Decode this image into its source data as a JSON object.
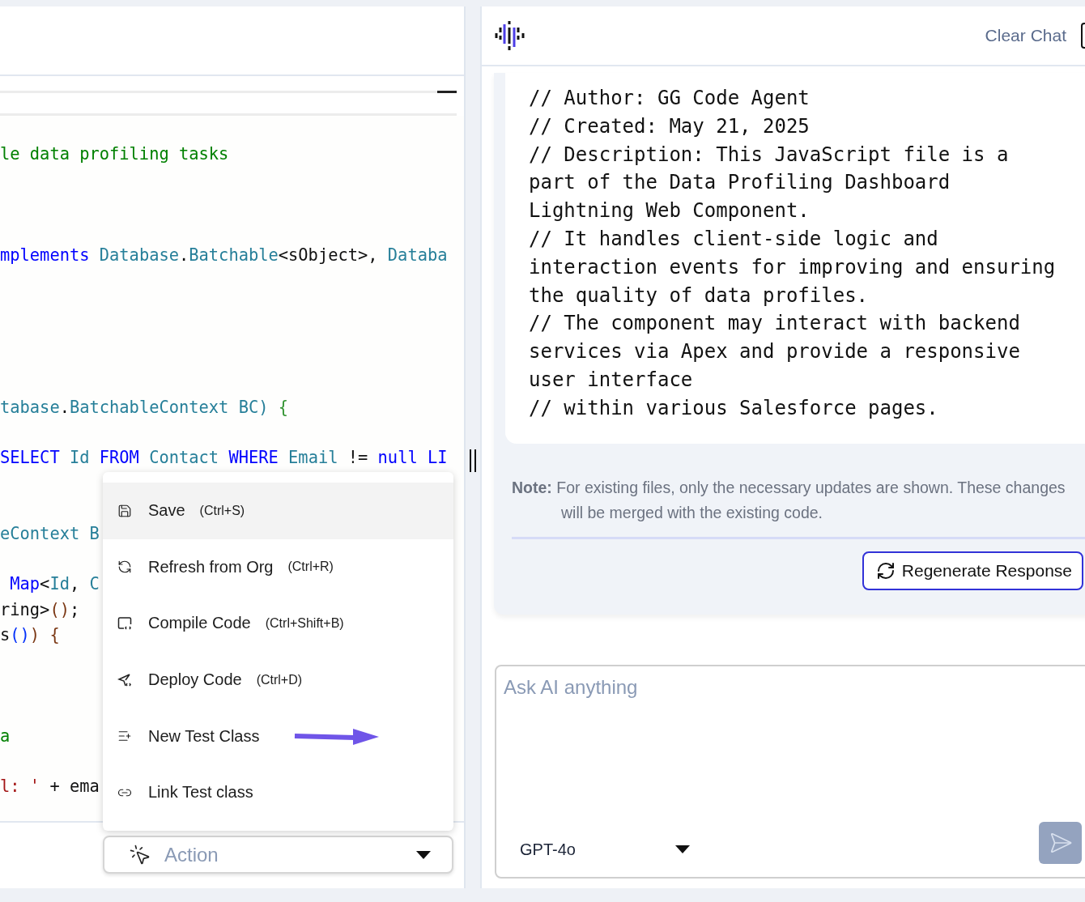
{
  "editor": {
    "code_lines": [
      {
        "kind": "code",
        "tokens": [
          {
            "text": "le data profiling tasks",
            "kind": "comment"
          }
        ]
      },
      {
        "kind": "blank"
      },
      {
        "kind": "blank"
      },
      {
        "kind": "blank"
      },
      {
        "kind": "code",
        "tokens": [
          {
            "text": "mplements",
            "kind": "keyword"
          },
          {
            "text": " Database",
            "kind": "type"
          },
          {
            "text": ".",
            "kind": "plain"
          },
          {
            "text": "Batchable",
            "kind": "type"
          },
          {
            "text": "<sObject>, ",
            "kind": "plain"
          },
          {
            "text": "Databa",
            "kind": "type"
          }
        ]
      },
      {
        "kind": "blank"
      },
      {
        "kind": "blank"
      },
      {
        "kind": "blank"
      },
      {
        "kind": "blank"
      },
      {
        "kind": "blank"
      },
      {
        "kind": "code",
        "tokens": [
          {
            "text": "tabase",
            "kind": "type"
          },
          {
            "text": ".",
            "kind": "plain"
          },
          {
            "text": "BatchableContext BC)",
            "kind": "type"
          },
          {
            "text": " {",
            "kind": "bracket_green"
          }
        ]
      },
      {
        "kind": "blank"
      },
      {
        "kind": "code",
        "tokens": [
          {
            "text": "SELECT",
            "kind": "keyword"
          },
          {
            "text": " Id",
            "kind": "type"
          },
          {
            "text": " FROM",
            "kind": "keyword"
          },
          {
            "text": " Contact",
            "kind": "type"
          },
          {
            "text": " WHERE",
            "kind": "keyword"
          },
          {
            "text": " Email",
            "kind": "type"
          },
          {
            "text": " != ",
            "kind": "plain"
          },
          {
            "text": "null LI",
            "kind": "keyword"
          }
        ]
      },
      {
        "kind": "blank"
      },
      {
        "kind": "blank"
      },
      {
        "kind": "code",
        "tokens": [
          {
            "text": "eContext B",
            "kind": "type"
          }
        ]
      },
      {
        "kind": "blank"
      },
      {
        "kind": "code",
        "tokens": [
          {
            "text": " Map",
            "kind": "keyword"
          },
          {
            "text": "<",
            "kind": "plain"
          },
          {
            "text": "Id",
            "kind": "type"
          },
          {
            "text": ", ",
            "kind": "plain"
          },
          {
            "text": "C",
            "kind": "type"
          }
        ]
      },
      {
        "kind": "code",
        "tokens": [
          {
            "text": "ring>",
            "kind": "plain"
          },
          {
            "text": "()",
            "kind": "bracket_brown"
          },
          {
            "text": ";",
            "kind": "plain"
          }
        ]
      },
      {
        "kind": "code",
        "tokens": [
          {
            "text": "s",
            "kind": "plain"
          },
          {
            "text": "()",
            "kind": "bracket_blue"
          },
          {
            "text": ") {",
            "kind": "bracket_brown"
          }
        ]
      },
      {
        "kind": "blank"
      },
      {
        "kind": "blank"
      },
      {
        "kind": "blank"
      },
      {
        "kind": "code",
        "tokens": [
          {
            "text": "a",
            "kind": "comment"
          }
        ]
      },
      {
        "kind": "blank"
      },
      {
        "kind": "code",
        "tokens": [
          {
            "text": "l: '",
            "kind": "string"
          },
          {
            "text": " + ema",
            "kind": "plain"
          }
        ]
      }
    ],
    "action_menu": [
      {
        "label": "Save",
        "shortcut": "(Ctrl+S)",
        "selected": true
      },
      {
        "label": "Refresh from Org",
        "shortcut": "(Ctrl+R)",
        "selected": false
      },
      {
        "label": "Compile Code",
        "shortcut": "(Ctrl+Shift+B)",
        "selected": false
      },
      {
        "label": "Deploy Code",
        "shortcut": "(Ctrl+D)",
        "selected": false
      },
      {
        "label": "New Test Class",
        "selected": false
      },
      {
        "label": "Link Test class",
        "selected": false
      }
    ],
    "action_dropdown": {
      "label": "Action"
    }
  },
  "chat": {
    "clear_button": "Clear Chat",
    "code_comment_lines": [
      "// Author: GG Code Agent",
      "// Created: May 21, 2025",
      "// Description: This JavaScript file is a part of the Data Profiling Dashboard Lightning Web Component.",
      "// It handles client-side logic and interaction events for improving and ensuring the quality of data profiles.",
      "// The component may interact with backend services via Apex and provide a responsive user interface",
      "// within various Salesforce pages."
    ],
    "note": "**Note:** For existing files, only the necessary updates are shown. These changes will be merged with the existing code.",
    "regenerate_button": "Regenerate Response",
    "input": {
      "placeholder": "Ask AI anything"
    },
    "model_select": {
      "value": "GPT-4o"
    }
  }
}
